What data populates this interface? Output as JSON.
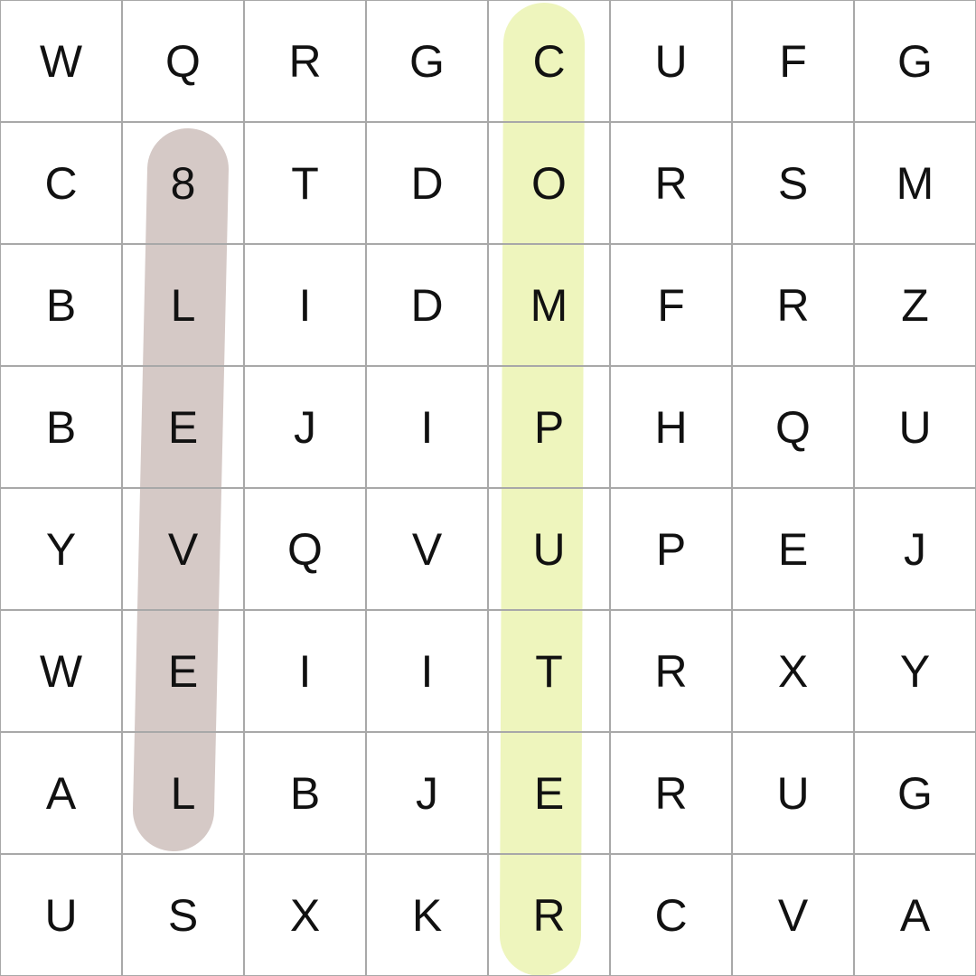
{
  "puzzle": {
    "rows": [
      [
        "W",
        "Q",
        "R",
        "G",
        "C",
        "U",
        "F",
        "G"
      ],
      [
        "C",
        "8",
        "T",
        "D",
        "O",
        "R",
        "S",
        "M"
      ],
      [
        "B",
        "L",
        "I",
        "D",
        "M",
        "F",
        "R",
        "Z"
      ],
      [
        "B",
        "E",
        "J",
        "I",
        "P",
        "H",
        "Q",
        "U"
      ],
      [
        "Y",
        "V",
        "Q",
        "V",
        "U",
        "P",
        "E",
        "J"
      ],
      [
        "W",
        "E",
        "I",
        "I",
        "T",
        "R",
        "X",
        "Y"
      ],
      [
        "A",
        "L",
        "B",
        "J",
        "E",
        "R",
        "U",
        "G"
      ],
      [
        "U",
        "S",
        "X",
        "K",
        "R",
        "C",
        "V",
        "A"
      ]
    ],
    "found_words": [
      {
        "word": "8LEVEL",
        "color": "#d5c9c6",
        "start": [
          1,
          1
        ],
        "end": [
          6,
          1
        ]
      },
      {
        "word": "COMPUTER",
        "color": "#eef5bd",
        "start": [
          0,
          4
        ],
        "end": [
          7,
          4
        ]
      }
    ]
  }
}
